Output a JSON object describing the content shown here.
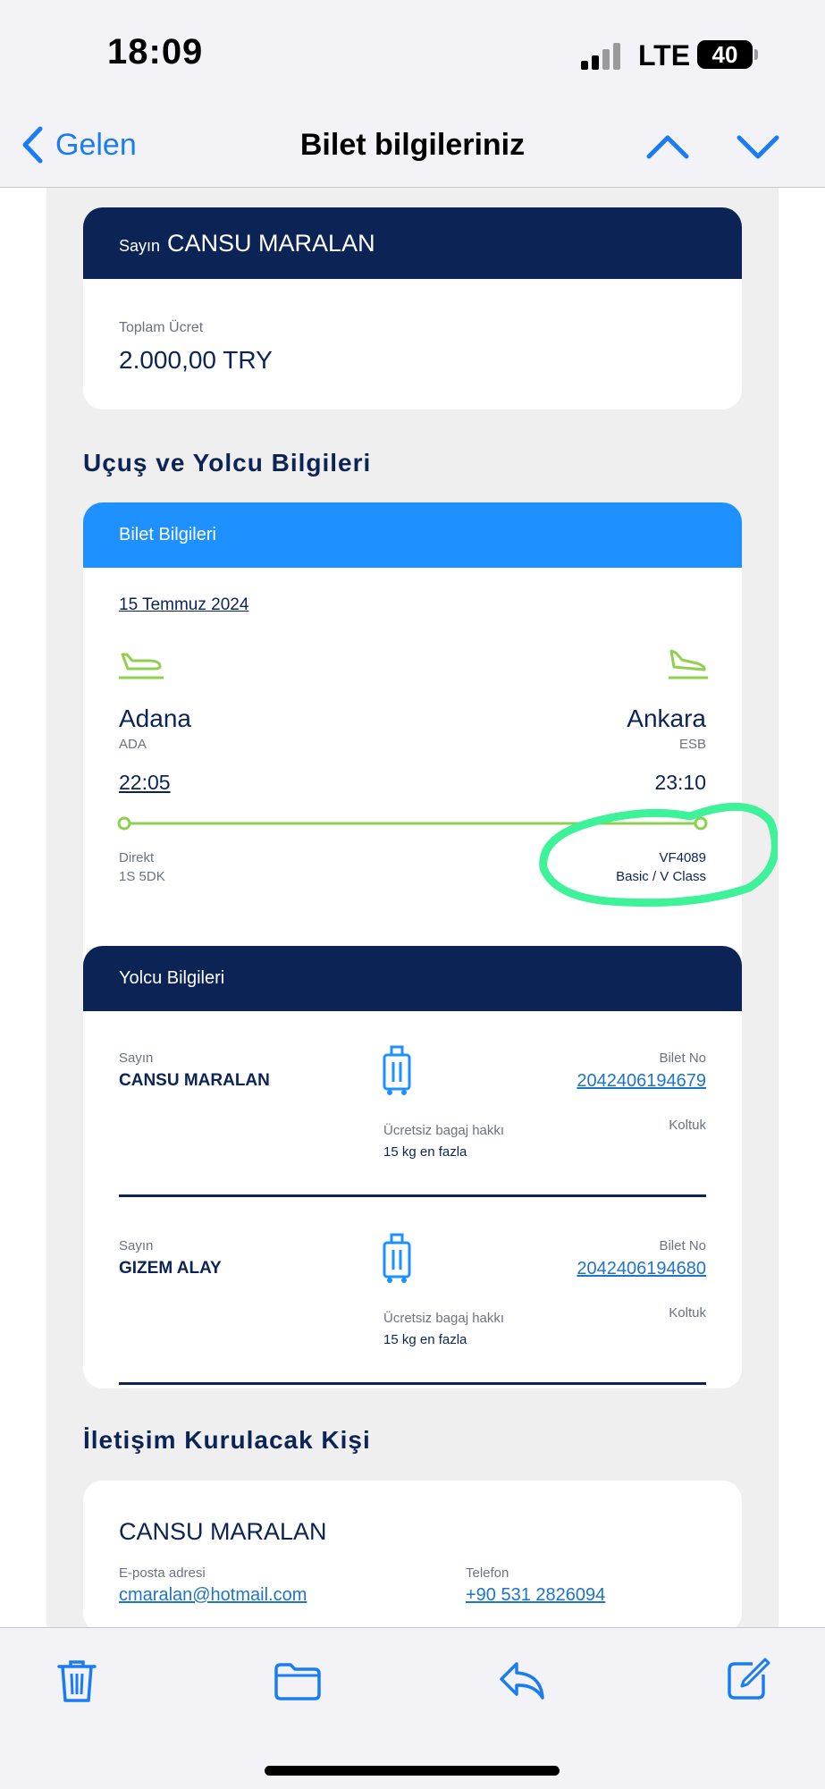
{
  "status": {
    "time": "18:09",
    "network": "LTE",
    "battery": "40"
  },
  "nav": {
    "back_label": "Gelen",
    "title": "Bilet bilgileriniz"
  },
  "summary": {
    "salutation": "Sayın",
    "name": "CANSU MARALAN",
    "total_label": "Toplam Ücret",
    "total_value": "2.000,00 TRY"
  },
  "flight_section_title": "Uçuş ve Yolcu Bilgileri",
  "ticket": {
    "header": "Bilet Bilgileri",
    "date": "15 Temmuz 2024",
    "origin": {
      "city": "Adana",
      "code": "ADA",
      "time": "22:05"
    },
    "destination": {
      "city": "Ankara",
      "code": "ESB",
      "time": "23:10"
    },
    "flight_type": "Direkt",
    "duration": "1S 5DK",
    "flight_no": "VF4089",
    "class": "Basic / V Class"
  },
  "passengers_header": "Yolcu Bilgileri",
  "passengers": [
    {
      "salutation": "Sayın",
      "name": "CANSU MARALAN",
      "baggage_label": "Ücretsiz bagaj hakkı",
      "baggage_value": "15 kg en fazla",
      "ticket_label": "Bilet No",
      "ticket_no": "2042406194679",
      "seat_label": "Koltuk"
    },
    {
      "salutation": "Sayın",
      "name": "GIZEM ALAY",
      "baggage_label": "Ücretsiz bagaj hakkı",
      "baggage_value": "15 kg en fazla",
      "ticket_label": "Bilet No",
      "ticket_no": "2042406194680",
      "seat_label": "Koltuk"
    }
  ],
  "contact_section_title": "İletişim Kurulacak Kişi",
  "contact": {
    "name": "CANSU MARALAN",
    "email_label": "E-posta adresi",
    "email": "cmaralan@hotmail.com",
    "phone_label": "Telefon",
    "phone": "+90 531 2826094"
  },
  "colors": {
    "navy": "#0c2455",
    "blue": "#1e90ff",
    "green": "#8fd14f",
    "highlight": "#3ef29a",
    "ios_blue": "#1a7cf2"
  },
  "icons": [
    "trash-icon",
    "folder-icon",
    "reply-icon",
    "compose-icon"
  ]
}
